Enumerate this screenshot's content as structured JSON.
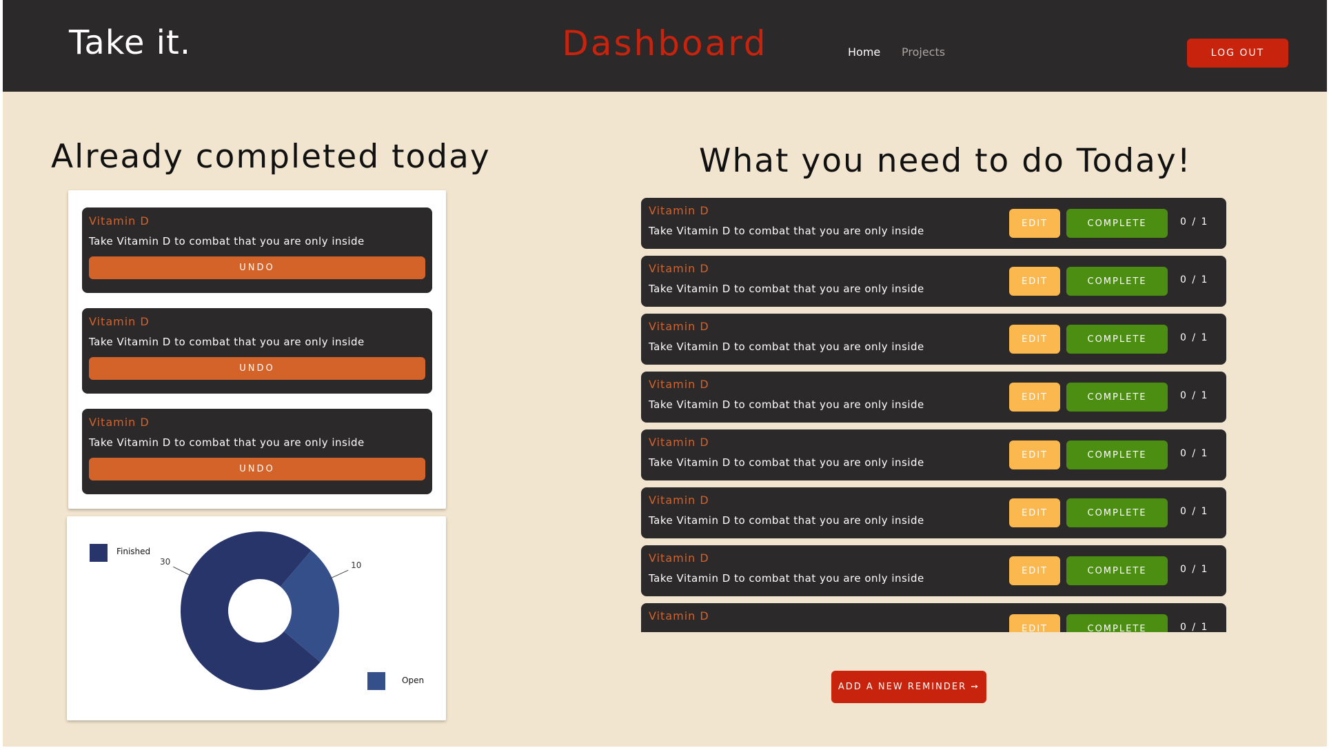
{
  "header": {
    "brand": "Take it.",
    "page_title": "Dashboard",
    "nav": [
      {
        "label": "Home",
        "active": true
      },
      {
        "label": "Projects",
        "active": false
      }
    ],
    "logout_label": "LOG OUT"
  },
  "completed": {
    "heading": "Already completed today",
    "items": [
      {
        "title": "Vitamin D",
        "description": "Take Vitamin D to combat that you are only inside",
        "undo_label": "UNDO"
      },
      {
        "title": "Vitamin D",
        "description": "Take Vitamin D to combat that you are only inside",
        "undo_label": "UNDO"
      },
      {
        "title": "Vitamin D",
        "description": "Take Vitamin D to combat that you are only inside",
        "undo_label": "UNDO"
      }
    ]
  },
  "chart_data": {
    "type": "pie",
    "donut": true,
    "categories": [
      "Finished",
      "Open"
    ],
    "values": [
      30,
      10
    ],
    "data_labels": [
      "30",
      "10"
    ],
    "colors": [
      "#27356b",
      "#344f8a"
    ],
    "legend_labels": [
      "Finished",
      "Open"
    ]
  },
  "todo": {
    "heading": "What you need to do Today!",
    "items": [
      {
        "title": "Vitamin D",
        "description": "Take Vitamin D to combat that you are only inside",
        "edit_label": "EDIT",
        "complete_label": "COMPLETE",
        "progress": "0 / 1"
      },
      {
        "title": "Vitamin D",
        "description": "Take Vitamin D to combat that you are only inside",
        "edit_label": "EDIT",
        "complete_label": "COMPLETE",
        "progress": "0 / 1"
      },
      {
        "title": "Vitamin D",
        "description": "Take Vitamin D to combat that you are only inside",
        "edit_label": "EDIT",
        "complete_label": "COMPLETE",
        "progress": "0 / 1"
      },
      {
        "title": "Vitamin D",
        "description": "Take Vitamin D to combat that you are only inside",
        "edit_label": "EDIT",
        "complete_label": "COMPLETE",
        "progress": "0 / 1"
      },
      {
        "title": "Vitamin D",
        "description": "Take Vitamin D to combat that you are only inside",
        "edit_label": "EDIT",
        "complete_label": "COMPLETE",
        "progress": "0 / 1"
      },
      {
        "title": "Vitamin D",
        "description": "Take Vitamin D to combat that you are only inside",
        "edit_label": "EDIT",
        "complete_label": "COMPLETE",
        "progress": "0 / 1"
      },
      {
        "title": "Vitamin D",
        "description": "Take Vitamin D to combat that you are only inside",
        "edit_label": "EDIT",
        "complete_label": "COMPLETE",
        "progress": "0 / 1"
      },
      {
        "title": "Vitamin D",
        "description": "",
        "edit_label": "EDIT",
        "complete_label": "COMPLETE",
        "progress": "0 / 1"
      }
    ],
    "add_label": "ADD A NEW REMINDER ➙"
  },
  "colors": {
    "header_bg": "#2b292a",
    "page_bg": "#f2e5cf",
    "accent_red": "#c8230d",
    "accent_orange": "#d4632a",
    "edit_yellow": "#fbb84e",
    "complete_green": "#4b8e12"
  }
}
